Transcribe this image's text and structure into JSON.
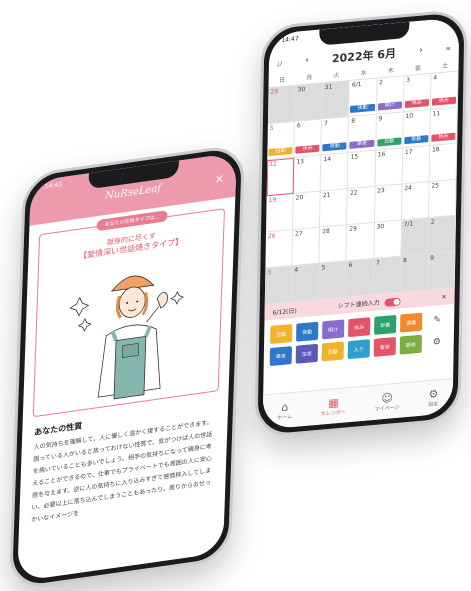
{
  "calendar_phone": {
    "status_time": "14:47",
    "month_title": "2022年 6月",
    "prev_arrow": "‹",
    "next_arrow": "›",
    "left_label": "¿/",
    "right_label": "≡",
    "weekdays": [
      "日",
      "月",
      "火",
      "水",
      "木",
      "金",
      "土"
    ],
    "rows": [
      [
        {
          "d": "29",
          "g": true
        },
        {
          "d": "30",
          "g": true
        },
        {
          "d": "31",
          "g": true
        },
        {
          "d": "6/1",
          "c": "#2f78c8",
          "t": "夜勤"
        },
        {
          "d": "2",
          "c": "#8b6cc9",
          "t": "明け"
        },
        {
          "d": "3",
          "c": "#e3546b",
          "t": "休み"
        },
        {
          "d": "4",
          "c": "#e3546b",
          "t": "休み"
        }
      ],
      [
        {
          "d": "5",
          "c": "#f0b32e",
          "t": "日勤"
        },
        {
          "d": "6",
          "c": "#e3546b",
          "t": "休み"
        },
        {
          "d": "7",
          "c": "#2f78c8",
          "t": "夜勤"
        },
        {
          "d": "8",
          "c": "#8b6cc9",
          "t": "準夜"
        },
        {
          "d": "9",
          "c": "#2aa36a",
          "t": "日勤"
        },
        {
          "d": "10",
          "c": "#2f78c8",
          "t": "夜勤"
        },
        {
          "d": "11",
          "c": "#e3546b",
          "t": "休み"
        }
      ],
      [
        {
          "d": "12",
          "sel": true
        },
        {
          "d": "13"
        },
        {
          "d": "14"
        },
        {
          "d": "15"
        },
        {
          "d": "16"
        },
        {
          "d": "17"
        },
        {
          "d": "18"
        }
      ],
      [
        {
          "d": "19"
        },
        {
          "d": "20"
        },
        {
          "d": "21"
        },
        {
          "d": "22"
        },
        {
          "d": "23"
        },
        {
          "d": "24"
        },
        {
          "d": "25"
        }
      ],
      [
        {
          "d": "26"
        },
        {
          "d": "27"
        },
        {
          "d": "28"
        },
        {
          "d": "29"
        },
        {
          "d": "30"
        },
        {
          "d": "7/1",
          "g": true
        },
        {
          "d": "2",
          "g": true
        }
      ],
      [
        {
          "d": "3",
          "g": true
        },
        {
          "d": "4",
          "g": true
        },
        {
          "d": "5",
          "g": true
        },
        {
          "d": "6",
          "g": true
        },
        {
          "d": "7",
          "g": true
        },
        {
          "d": "8",
          "g": true
        },
        {
          "d": "9",
          "g": true
        }
      ]
    ],
    "selected_date": "6/12(日)",
    "shift_toggle_label": "シフト連続入力",
    "close_label": "✕",
    "shift_buttons": [
      {
        "t": "日勤",
        "c": "#f0b32e"
      },
      {
        "t": "夜勤",
        "c": "#2f78c8"
      },
      {
        "t": "明け",
        "c": "#8b6cc9"
      },
      {
        "t": "休み",
        "c": "#e3546b"
      },
      {
        "t": "早番",
        "c": "#2aa36a"
      },
      {
        "t": "遅番",
        "c": "#f08a2e"
      },
      {
        "t": "✎",
        "c": "tool"
      },
      {
        "t": "準夜",
        "c": "#2f78c8"
      },
      {
        "t": "深夜",
        "c": "#5a58b8"
      },
      {
        "t": "日勤",
        "c": "#f0b32e"
      },
      {
        "t": "入り",
        "c": "#2f9fd0"
      },
      {
        "t": "有休",
        "c": "#e3546b"
      },
      {
        "t": "研修",
        "c": "#7cae3f"
      },
      {
        "t": "⚙",
        "c": "tool"
      }
    ],
    "tabs": [
      {
        "icon": "⌂",
        "label": "ホーム"
      },
      {
        "icon": "▦",
        "label": "カレンダー",
        "active": true
      },
      {
        "icon": "☺",
        "label": "マイページ"
      },
      {
        "icon": "⚙",
        "label": "設定"
      }
    ]
  },
  "result_phone": {
    "status_time": "14:43",
    "logo": "NuRseLeaf",
    "close_label": "✕",
    "badge": "あなたの性格タイプは…",
    "type_line1": "献身的に尽くす",
    "type_line2": "【愛情深い世話焼きタイプ】",
    "section_title": "あなたの性質",
    "section_text": "人の気持ちを理解して、人に優しく温かく接することができます。困っている人がいると放っておけない性質で、気がつけば人の世話を焼いていることも多いでしょう。相手の気持ちになって親身に考えることができるので、仕事でもプライベートでも周囲の人に安心感を与えます。逆に人の気持ちに入り込みすぎて感情移入してしまい、必要以上に落ち込んでしまうこともあったり、周りからおせっかいなイメージを"
  },
  "colors": {
    "accent_pink": "#e3546b",
    "header_pink": "#ec9aac"
  }
}
